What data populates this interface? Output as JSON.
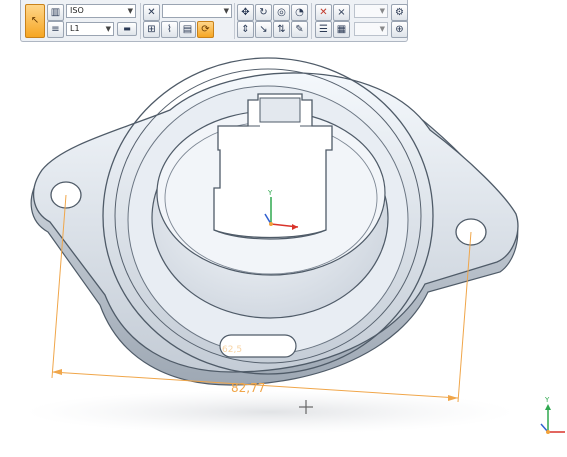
{
  "toolbar": {
    "view_select": "ISO",
    "layer_select": "L1",
    "style_select_1": "",
    "style_select_2": "",
    "style_select_3": "",
    "style_select_4": "",
    "close_label": "×"
  },
  "viewport": {
    "dimension_value": "82,77",
    "hidden_dimension_value": "62,5"
  },
  "colors": {
    "dimension": "#f0a64a",
    "part_edge": "#4f5b68",
    "axis_x": "#d9342b",
    "axis_y": "#2fa84f",
    "axis_z": "#2f5fd0"
  },
  "icons": [
    "select-cursor-icon",
    "bar-chart-icon",
    "snap-icon",
    "active-tool-icon",
    "grid-icon",
    "line-style-icon",
    "pan-icon",
    "rotate-icon",
    "zoom-icon",
    "fit-view-icon",
    "delete-icon",
    "close-icon",
    "section-icon",
    "measure-icon",
    "settings-icon",
    "triad-icon",
    "origin-marker-icon"
  ]
}
